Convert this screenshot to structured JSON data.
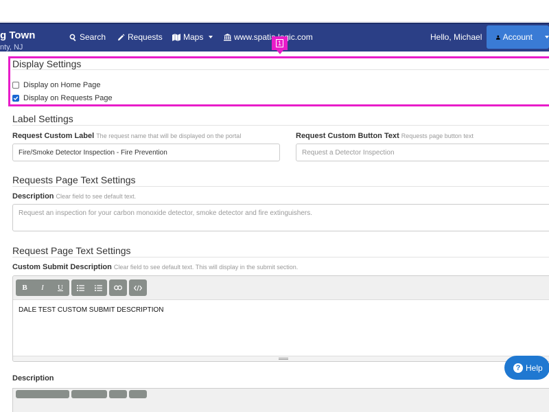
{
  "navbar": {
    "brand_title": "g Town",
    "brand_subtitle": "nty, NJ",
    "search_label": "Search",
    "requests_label": "Requests",
    "maps_label": "Maps",
    "site_link": "www.spatia  logic.com",
    "greeting": "Hello, Michael",
    "account_label": "Account"
  },
  "annotation": {
    "marker": "1",
    "color": "#e81cc9"
  },
  "display_settings": {
    "title": "Display Settings",
    "options": [
      {
        "label": "Display on Home Page",
        "checked": false
      },
      {
        "label": "Display on Requests Page",
        "checked": true
      }
    ]
  },
  "label_settings": {
    "title": "Label Settings",
    "custom_label": {
      "label": "Request Custom Label",
      "hint": "The request name that will be displayed on the portal",
      "value": "Fire/Smoke Detector Inspection - Fire Prevention"
    },
    "custom_button": {
      "label": "Request Custom Button Text",
      "hint": "Requests page button text",
      "placeholder": "Request a Detector Inspection"
    }
  },
  "requests_page_text": {
    "title": "Requests Page Text Settings",
    "description_label": "Description",
    "description_hint": "Clear field to see default text.",
    "description_placeholder": "Request an inspection for your carbon monoxide detector, smoke detector and fire extinguishers."
  },
  "request_page_text": {
    "title": "Request Page Text Settings",
    "submit_label": "Custom Submit Description",
    "submit_hint": "Clear field to see default text. This will display in the submit section.",
    "submit_content": "DALE TEST CUSTOM SUBMIT DESCRIPTION",
    "toolbar": {
      "bold": "B",
      "italic": "I",
      "underline": "U"
    },
    "description_label": "Description"
  },
  "help_button": {
    "label": "Help"
  },
  "colors": {
    "navbar": "#2b3f86",
    "account": "#3a7bd5",
    "highlight": "#e81cc9",
    "help": "#1f78d1",
    "checkbox": "#1967d2"
  }
}
